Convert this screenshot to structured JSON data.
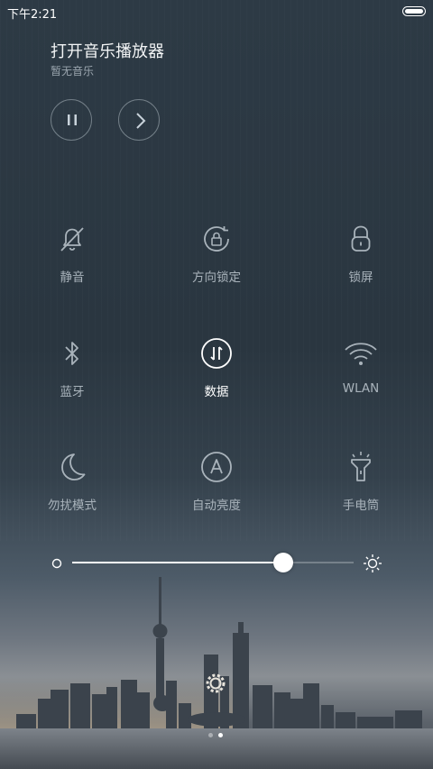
{
  "status_bar": {
    "time": "下午2:21"
  },
  "music": {
    "title": "打开音乐播放器",
    "subtitle": "暂无音乐"
  },
  "toggles": [
    {
      "label": "静音",
      "icon": "bell-off-icon",
      "active": false
    },
    {
      "label": "方向锁定",
      "icon": "rotation-lock-icon",
      "active": false
    },
    {
      "label": "锁屏",
      "icon": "lock-icon",
      "active": false
    },
    {
      "label": "蓝牙",
      "icon": "bluetooth-icon",
      "active": false
    },
    {
      "label": "数据",
      "icon": "mobile-data-icon",
      "active": true
    },
    {
      "label": "WLAN",
      "icon": "wifi-icon",
      "active": false
    },
    {
      "label": "勿扰模式",
      "icon": "moon-icon",
      "active": false
    },
    {
      "label": "自动亮度",
      "icon": "auto-brightness-icon",
      "active": false
    },
    {
      "label": "手电筒",
      "icon": "flashlight-icon",
      "active": false
    }
  ],
  "brightness": {
    "value": 0.75
  },
  "pager": {
    "pages": 2,
    "current": 1
  },
  "colors": {
    "active": "#ffffff",
    "inactive": "#a9b3bb"
  }
}
